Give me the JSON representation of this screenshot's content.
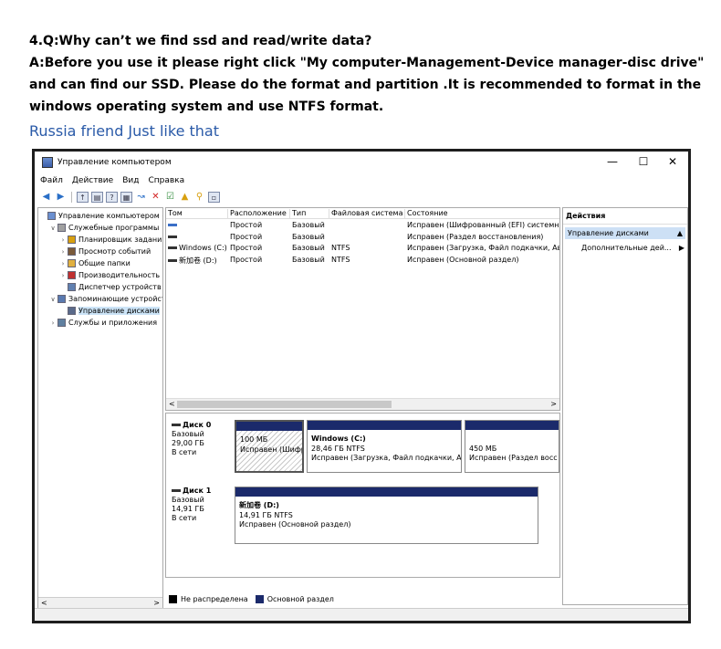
{
  "faq": {
    "question": "4.Q:Why can’t we find ssd and read/write data?",
    "answer": "A:Before you use it please right click \"My computer-Management-Device manager-disc drive\" and can find our SSD. Please do the format and partition .It is recommended to format in the windows operating system and use NTFS format.",
    "note": "Russia friend Just like that"
  },
  "window": {
    "title": "Управление компьютером",
    "minimize": "—",
    "maximize": "☐",
    "close": "✕"
  },
  "menu": [
    "Файл",
    "Действие",
    "Вид",
    "Справка"
  ],
  "tree": [
    {
      "label": "Управление компьютером (л",
      "arrow": "",
      "icon_color": "#6a8fd0",
      "indent": 0
    },
    {
      "label": "Служебные программы",
      "arrow": "∨",
      "icon_color": "#a0a0a0",
      "indent": 1
    },
    {
      "label": "Планировщик заданий",
      "arrow": "›",
      "icon_color": "#d8a010",
      "indent": 2
    },
    {
      "label": "Просмотр событий",
      "arrow": "›",
      "icon_color": "#7a5a3a",
      "indent": 2
    },
    {
      "label": "Общие папки",
      "arrow": "›",
      "icon_color": "#e0b040",
      "indent": 2
    },
    {
      "label": "Производительность",
      "arrow": "›",
      "icon_color": "#c03030",
      "indent": 2
    },
    {
      "label": "Диспетчер устройств",
      "arrow": "",
      "icon_color": "#6080b0",
      "indent": 2
    },
    {
      "label": "Запоминающие устройст",
      "arrow": "∨",
      "icon_color": "#5a7ab0",
      "indent": 1
    },
    {
      "label": "Управление дисками",
      "arrow": "",
      "icon_color": "#5a6a8a",
      "indent": 2,
      "selected": true
    },
    {
      "label": "Службы и приложения",
      "arrow": "›",
      "icon_color": "#6080a0",
      "indent": 1
    }
  ],
  "volumes": {
    "columns": [
      "Том",
      "Расположение",
      "Тип",
      "Файловая система",
      "Состояние"
    ],
    "rows": [
      {
        "name": "",
        "layout": "Простой",
        "type": "Базовый",
        "fs": "",
        "status": "Исправен (Шифрованный (EFI) системный",
        "dash": "blue"
      },
      {
        "name": "",
        "layout": "Простой",
        "type": "Базовый",
        "fs": "",
        "status": "Исправен (Раздел восстановления)",
        "dash": "black"
      },
      {
        "name": "Windows (C:)",
        "layout": "Простой",
        "type": "Базовый",
        "fs": "NTFS",
        "status": "Исправен (Загрузка, Файл подкачки, Ава",
        "dash": "black"
      },
      {
        "name": "新加卷 (D:)",
        "layout": "Простой",
        "type": "Базовый",
        "fs": "NTFS",
        "status": "Исправен (Основной раздел)",
        "dash": "black"
      }
    ]
  },
  "disks": [
    {
      "name": "Диск 0",
      "type": "Базовый",
      "size": "29,00 ГБ",
      "state": "В сети",
      "partitions": [
        {
          "title": "",
          "size": "100 МБ",
          "status": "Исправен (Шифр"
        },
        {
          "title": "Windows (C:)",
          "size": "28,46 ГБ NTFS",
          "status": "Исправен (Загрузка, Файл подкачки, Ава"
        },
        {
          "title": "",
          "size": "450 МБ",
          "status": "Исправен (Раздел восс"
        }
      ]
    },
    {
      "name": "Диск 1",
      "type": "Базовый",
      "size": "14,91 ГБ",
      "state": "В сети",
      "partitions": [
        {
          "title": "新加卷 (D:)",
          "size": "14,91 ГБ NTFS",
          "status": "Исправен (Основной раздел)"
        }
      ]
    }
  ],
  "legend": {
    "unallocated": "Не распределена",
    "primary": "Основной раздел"
  },
  "actions": {
    "header": "Действия",
    "selected": "Управление дисками",
    "selected_arrow": "▲",
    "more": "Дополнительные дей...",
    "more_arrow": "▶"
  },
  "scroll": {
    "left": "<",
    "right": ">"
  }
}
